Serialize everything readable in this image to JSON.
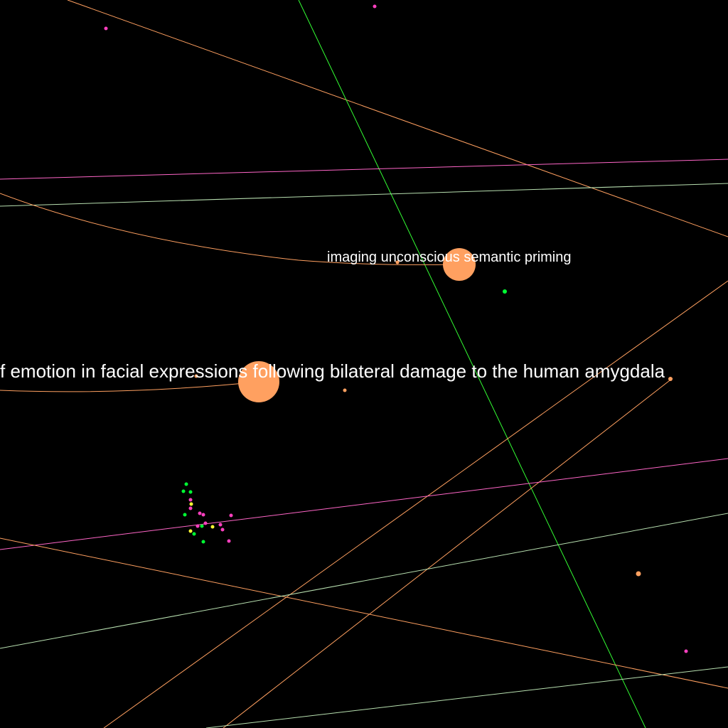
{
  "graph": {
    "background": "#000000",
    "colors": {
      "orange": "#ffa060",
      "green": "#00ff33",
      "magenta": "#ff40c0",
      "yellow": "#ffff33",
      "pale_green": "#b8e0b0",
      "pink_line": "#ff66c8"
    },
    "labels": {
      "label_amygdala": "f emotion in facial expressions following bilateral damage to the human amygdala",
      "label_priming": "imaging unconscious semantic priming"
    }
  }
}
